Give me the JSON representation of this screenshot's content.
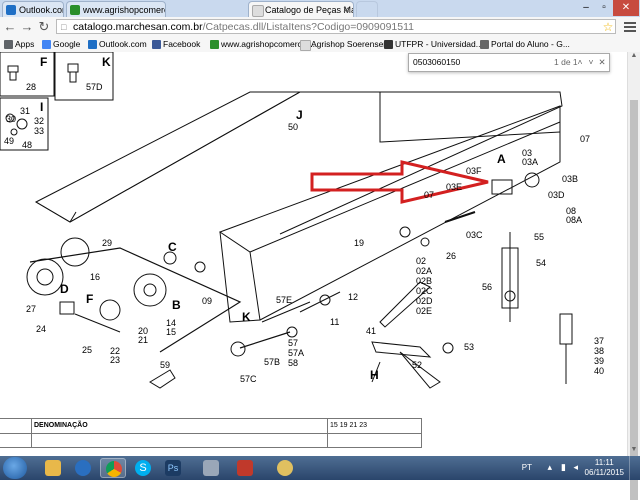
{
  "browser": {
    "tabs": [
      {
        "label": "Outlook.com - agrishop",
        "favicon_color": "#1f6fc5",
        "active": false
      },
      {
        "label": "www.agrishopcomercial.c",
        "favicon_color": "#2a8f2a",
        "active": false
      },
      {
        "label": "Catalogo de Peças Marcha",
        "favicon_color": "#cccccc",
        "active": true
      }
    ],
    "url_host": "catalogo.marchesan.com.br",
    "url_path": "/Catpecas.dll/ListaItens?Codigo=0909091511",
    "bookmarks": [
      {
        "label": "Apps",
        "icon_color": "#5f6368"
      },
      {
        "label": "Google",
        "icon_color": "#4285f4"
      },
      {
        "label": "Outlook.com",
        "icon_color": "#1f6fc5"
      },
      {
        "label": "Facebook",
        "icon_color": "#3b5998"
      },
      {
        "label": "www.agrishopcomercial...",
        "icon_color": "#2a8f2a"
      },
      {
        "label": "Agrishop Soerensen",
        "icon_color": "#cccccc"
      },
      {
        "label": "UTFPR - Universidad...",
        "icon_color": "#333333"
      },
      {
        "label": "Portal do Aluno - G...",
        "icon_color": "#666666"
      }
    ],
    "find": {
      "query": "0503060150",
      "count": "1 de 1"
    }
  },
  "diagram": {
    "labels": {
      "F_top": "F",
      "n28": "28",
      "K_top": "K",
      "n57D": "57D",
      "I": "I",
      "n31": "31",
      "n30": "30",
      "n32": "32",
      "n33": "33",
      "n49": "49",
      "n48": "48",
      "J": "J",
      "n50": "50",
      "n07a": "07",
      "A": "A",
      "n03F": "03F",
      "n03": "03",
      "n03A": "03A",
      "n03E": "03E",
      "n07b": "07",
      "n03B": "03B",
      "n03D": "03D",
      "n08": "08",
      "n08A": "08A",
      "n03C": "03C",
      "n55": "55",
      "n54": "54",
      "n56": "56",
      "n19": "19",
      "n26": "26",
      "n02": "02",
      "n02A": "02A",
      "n02B": "02B",
      "n02C": "02C",
      "n02D": "02D",
      "n02E": "02E",
      "n29": "29",
      "n16": "16",
      "D": "D",
      "C": "C",
      "B": "B",
      "n09": "09",
      "n12": "12",
      "n57E": "57E",
      "n11": "11",
      "n27": "27",
      "F_mid": "F",
      "n24": "24",
      "n25": "25",
      "n22": "22",
      "n23": "23",
      "n20": "20",
      "n21": "21",
      "n14": "14",
      "n15": "15",
      "K_mid": "K",
      "n57B": "57B",
      "n57": "57",
      "n57A": "57A",
      "n58": "58",
      "n57C": "57C",
      "n59": "59",
      "n41": "41",
      "n52": "52",
      "n53": "53",
      "H": "H",
      "n37": "37",
      "n38": "38",
      "n39": "39",
      "n40": "40"
    }
  },
  "table": {
    "header_col1": "",
    "header_col2": "DENOMINAÇÃO",
    "header_col3": "15  19  21  23"
  },
  "taskbar": {
    "lang": "PT",
    "time": "11:11",
    "date": "06/11/2015",
    "apps": [
      {
        "name": "windows-explorer",
        "color": "#e8b84a"
      },
      {
        "name": "media-player",
        "color": "#2a6fc0"
      },
      {
        "name": "chrome",
        "color": "#dd4b39"
      },
      {
        "name": "skype",
        "color": "#00aff0"
      },
      {
        "name": "photoshop",
        "color": "#1c3b63"
      },
      {
        "name": "link-tool",
        "color": "#9aa7b8"
      },
      {
        "name": "tatu-app",
        "color": "#c0392b"
      },
      {
        "name": "paint",
        "color": "#e0c060"
      }
    ]
  }
}
